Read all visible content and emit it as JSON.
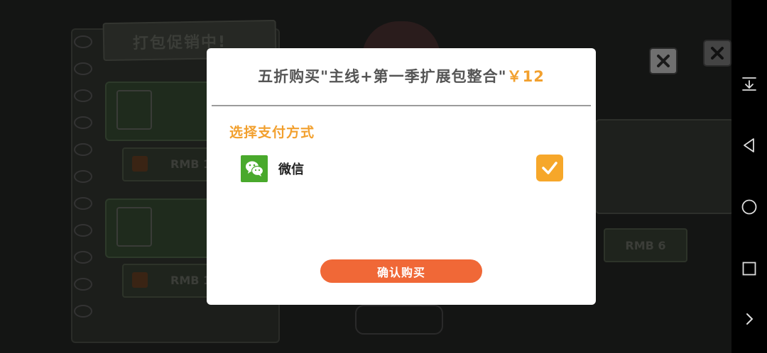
{
  "background": {
    "promo_tab": "打包促销中!",
    "price_labels": [
      "RMB 1",
      "RMB 1"
    ],
    "right_price": "RMB 6"
  },
  "dialog": {
    "title": "五折购买\"主线+第一季扩展包整合\"",
    "price": "￥12",
    "section_label": "选择支付方式",
    "payment_method": {
      "icon": "wechat-icon",
      "label": "微信",
      "selected": true
    },
    "confirm_label": "确认购买"
  },
  "colors": {
    "accent_orange": "#f2a02e",
    "confirm_button": "#f06837",
    "wechat_green": "#49a92c"
  },
  "navbar": {
    "icons": [
      "notification-pull-down-icon",
      "back-icon",
      "home-icon",
      "recents-icon",
      "expand-icon"
    ]
  }
}
